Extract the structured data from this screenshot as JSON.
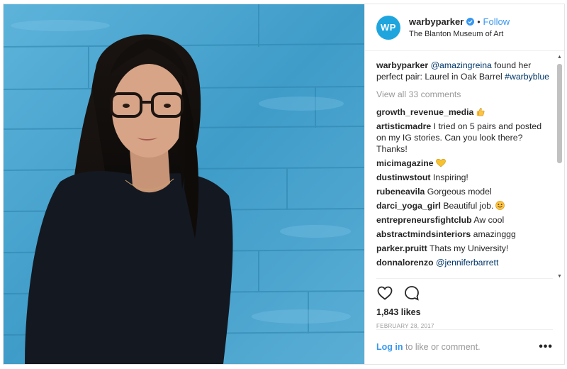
{
  "header": {
    "avatar_initials": "WP",
    "username": "warbyparker",
    "separator": "•",
    "follow_label": "Follow",
    "location": "The Blanton Museum of Art"
  },
  "caption": {
    "username": "warbyparker",
    "mention": "@amazingreina",
    "text": " found her perfect pair: Laurel in Oak Barrel ",
    "hashtag": "#warbyblue"
  },
  "view_all_label": "View all 33 comments",
  "comments": [
    {
      "user": "growth_revenue_media",
      "text": "",
      "emoji": "thumbs-up"
    },
    {
      "user": "artisticmadre",
      "text": " I tried on 5 pairs and posted on my IG stories. Can you look there? Thanks!",
      "emoji": ""
    },
    {
      "user": "micimagazine",
      "text": "",
      "emoji": "heart"
    },
    {
      "user": "dustinwstout",
      "text": " Inspiring!",
      "emoji": ""
    },
    {
      "user": "rubeneavila",
      "text": " Gorgeous model",
      "emoji": ""
    },
    {
      "user": "darci_yoga_girl",
      "text": " Beautiful job.",
      "emoji": "smile"
    },
    {
      "user": "entrepreneursfightclub",
      "text": " Aw cool",
      "emoji": ""
    },
    {
      "user": "abstractmindsinteriors",
      "text": " amazinggg",
      "emoji": ""
    },
    {
      "user": "parker.pruitt",
      "text": " Thats my University!",
      "emoji": ""
    },
    {
      "user": "donnalorenzo",
      "text": " ",
      "mention": "@jenniferbarrett",
      "emoji": ""
    }
  ],
  "likes": "1,843 likes",
  "date": "FEBRUARY 28, 2017",
  "footer": {
    "login_label": "Log in",
    "login_suffix": " to like or comment.",
    "more_label": "•••"
  },
  "colors": {
    "link_blue": "#3897f0",
    "avatar_blue": "#1fa5de",
    "wall_blue": "#4aa6cf"
  }
}
